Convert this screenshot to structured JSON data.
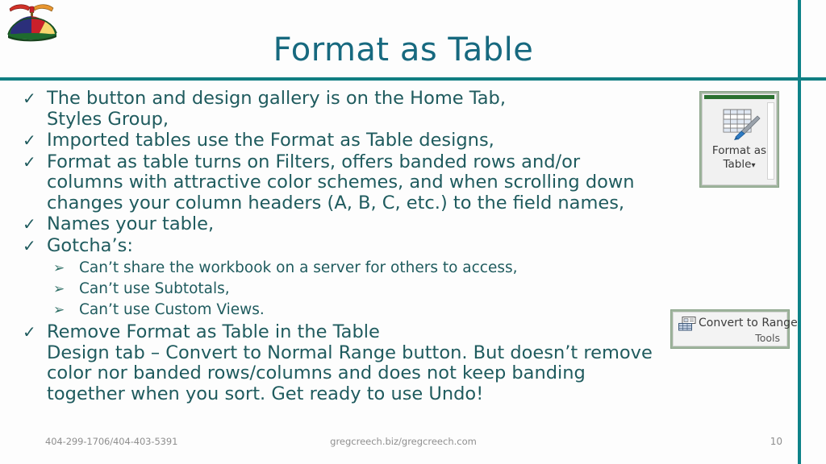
{
  "slide": {
    "title": "Format as Table",
    "colors": {
      "title": "#17697F",
      "body_text": "#1F5B5E",
      "rule": "#107E82",
      "footer_text": "#8f8f8f",
      "ribbon_green": "#2A7030"
    }
  },
  "logo": {
    "name": "propeller-beanie-logo",
    "colors": {
      "red": "#C9202A",
      "yellow": "#F5D76E",
      "navy": "#2B2F7A",
      "green_rim": "#1E6B2E",
      "propeller_red": "#D13128",
      "propeller_orange": "#E8952F"
    }
  },
  "bullets": [
    {
      "marker": "✓",
      "text": "The button and design gallery is on the Home Tab,\nStyles Group,"
    },
    {
      "marker": "✓",
      "text": "Imported tables use the Format as Table designs,"
    },
    {
      "marker": "✓",
      "text": "Format as table turns on Filters, offers banded rows and/or\ncolumns with attractive color schemes, and when scrolling down\nchanges your column headers (A, B, C, etc.) to the field names,"
    },
    {
      "marker": "✓",
      "text": "Names your table,"
    },
    {
      "marker": "✓",
      "text": "Gotcha’s:"
    },
    {
      "marker": "✓",
      "text": "Remove Format as Table in the Table\nDesign tab – Convert to Normal Range button. But doesn’t remove\ncolor nor banded rows/columns and does not keep banding\ntogether when you sort. Get ready to use Undo!"
    }
  ],
  "sub_bullets": [
    {
      "marker": "➢",
      "text": "Can’t share the workbook on a server for others to access,"
    },
    {
      "marker": "➢",
      "text": "Can’t use Subtotals,"
    },
    {
      "marker": "➢",
      "text": "Can’t use Custom Views."
    }
  ],
  "format_as_table_button": {
    "label_line1": "Format as",
    "label_line2": "Table",
    "dropdown_glyph": "▾",
    "icon_name": "table-with-brush-icon"
  },
  "convert_to_range_button": {
    "label": "Convert to Range",
    "group_label": "Tools",
    "icon_name": "convert-to-range-icon"
  },
  "footer": {
    "phone": "404-299-1706/404-403-5391",
    "website": "gregcreech.biz/gregcreech.com",
    "page_number": "10"
  }
}
